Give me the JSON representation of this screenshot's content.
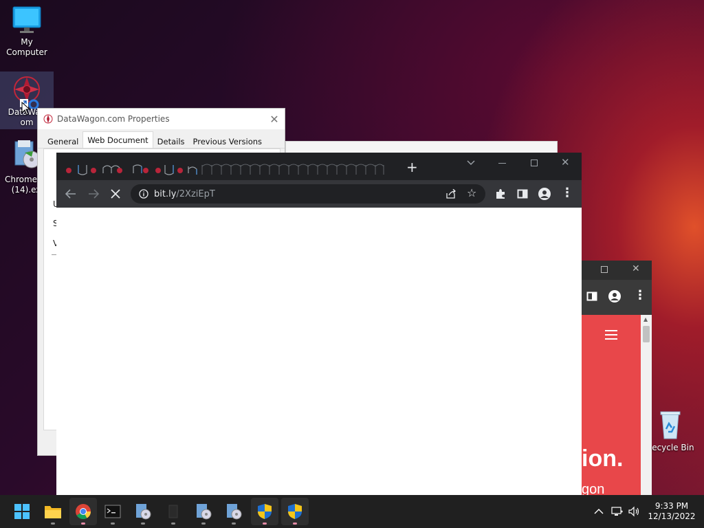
{
  "desktop": {
    "icons": [
      {
        "label": "My Computer",
        "icon": "monitor-icon"
      },
      {
        "label_line1": "DataWag",
        "label_line2": "om",
        "icon": "datawagon-shortcut-icon"
      },
      {
        "label_line1": "ChromeSe",
        "label_line2": "(14).ex",
        "icon": "installer-icon"
      },
      {
        "label": "Recycle Bin",
        "icon": "recycle-bin-icon"
      }
    ]
  },
  "properties_dialog": {
    "title": "DataWagon.com Properties",
    "tabs": [
      "General",
      "Web Document",
      "Details",
      "Previous Versions"
    ],
    "active_tab": "Web Document",
    "partial_labels": [
      "U",
      "S",
      "V"
    ]
  },
  "browser": {
    "url_host": "bit.ly",
    "url_path": "/2XziEpT",
    "new_tab_symbol": "+",
    "loading": true
  },
  "browser_behind": {
    "headline": "ion.",
    "subline": "gon"
  },
  "taskbar": {
    "apps": [
      "start-icon",
      "file-explorer-icon",
      "chrome-icon",
      "terminal-icon",
      "installer-icon",
      "blank-app-icon",
      "installer-icon",
      "installer-icon",
      "uac-shield-icon",
      "uac-shield-icon"
    ],
    "time": "9:33 PM",
    "date": "12/13/2022"
  },
  "colors": {
    "chrome_dark": "#202124",
    "page_accent": "#e8474a",
    "taskbar": "#202020"
  }
}
